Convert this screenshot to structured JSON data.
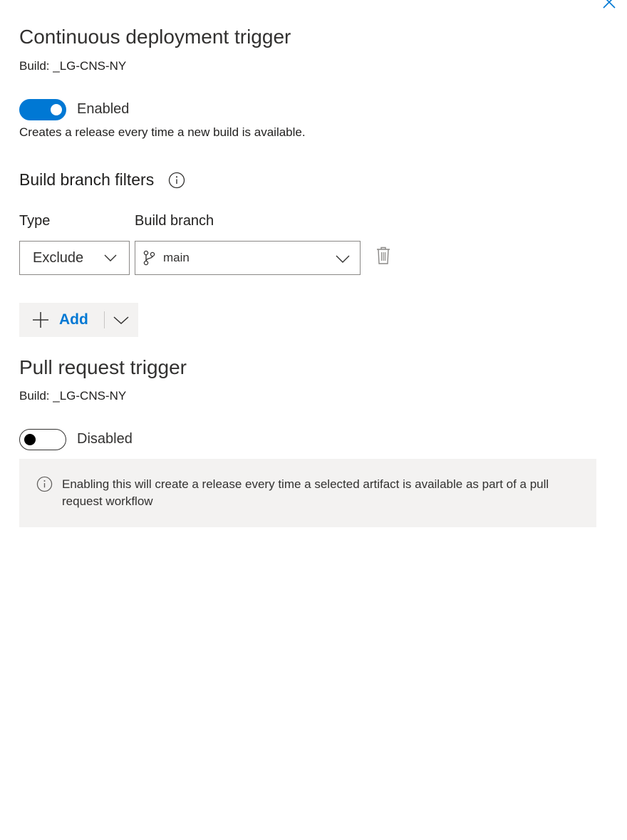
{
  "panel": {
    "close_icon": "close-icon"
  },
  "continuous_deployment": {
    "title": "Continuous deployment trigger",
    "build_label": "Build: _LG-CNS-NY",
    "toggle": {
      "state": "on",
      "label": "Enabled"
    },
    "description": "Creates a release every time a new build is available."
  },
  "branch_filters": {
    "title": "Build branch filters",
    "info_icon": "info-icon",
    "columns": {
      "type": "Type",
      "branch": "Build branch"
    },
    "rows": [
      {
        "type": "Exclude",
        "branch": "main"
      }
    ],
    "delete_icon": "trash-icon",
    "add_button": {
      "label": "Add",
      "icon": "plus-icon",
      "split_icon": "chevron-down-icon"
    }
  },
  "pull_request": {
    "title": "Pull request trigger",
    "build_label": "Build: _LG-CNS-NY",
    "toggle": {
      "state": "off",
      "label": "Disabled"
    },
    "info_message": "Enabling this will create a release every time a selected artifact is available as part of a pull request workflow"
  },
  "colors": {
    "accent": "#0078d4",
    "text": "#201f1e",
    "info_bg": "#f3f2f1"
  }
}
